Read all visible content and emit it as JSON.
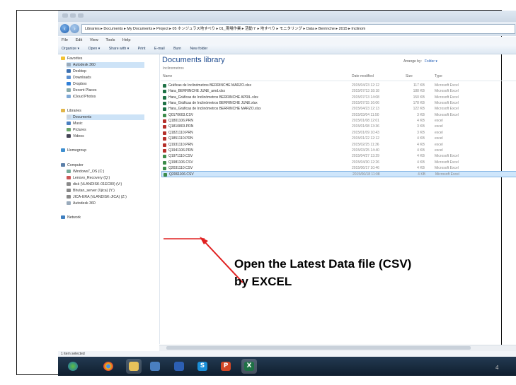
{
  "breadcrumb": "Libraries ▸ Documents ▸ My Documents ▸ Project ▸ 05 ホンジュラス地すべり ▸ 01_現場作業 ▸ 活動７ ▸ 地すべり ▸ モニタリング ▸ Data ▸ Berrinche ▸ 2015 ▸ Inclinom",
  "menu": [
    "File",
    "Edit",
    "View",
    "Tools",
    "Help"
  ],
  "toolbar": [
    "Organize ▾",
    "Open ▾",
    "Share with ▾",
    "Print",
    "E-mail",
    "Burn",
    "New folder"
  ],
  "nav": {
    "favorites": "Favorites",
    "favorites_items": [
      "Autodesk 360",
      "Desktop",
      "Downloads",
      "Dropbox",
      "Recent Places",
      "iCloud Photos"
    ],
    "libraries": "Libraries",
    "libraries_items": [
      "Documents",
      "Music",
      "Pictures",
      "Videos"
    ],
    "homegroup": "Homegroup",
    "computer": "Computer",
    "computer_items": [
      "Windows7_OS (C:)",
      "Lenovo_Recovery (Q:)",
      "disk (\\\\LANDISK-01EC80) (V:)",
      "Bhutan_server (\\\\jica) (Y:)",
      "JICA-ERA (\\\\LANDISK-JICA) (Z:)",
      "Autodesk 360"
    ],
    "network": "Network"
  },
  "library": {
    "title": "Documents library",
    "subtitle": "Inclinometros",
    "arrange_label": "Arrange by:",
    "arrange_value": "Folder ▾"
  },
  "columns": {
    "name": "Name",
    "date": "Date modified",
    "size": "Size",
    "type": "Type"
  },
  "files": [
    {
      "name": "Gráficas de Inclinómetros BERRINCHE MARZO.xlsx",
      "date": "2015/04/23 12:12",
      "size": "117 KB",
      "type": "Microsoft Excel",
      "kind": "xlsx"
    },
    {
      "name": "Hara_BERRINCHE JUNE_amd.xlsx",
      "date": "2015/07/13 18:18",
      "size": "188 KB",
      "type": "Microsoft Excel",
      "kind": "xlsx"
    },
    {
      "name": "Hara_Gráficas de Inclinómetros BERRINCHE APRIL.xlsx",
      "date": "2015/07/13 14:08",
      "size": "150 KB",
      "type": "Microsoft Excel",
      "kind": "xlsx"
    },
    {
      "name": "Hara_Gráficas de Inclinómetros BERRINCHE JUNE.xlsx",
      "date": "2015/07/15 16:06",
      "size": "178 KB",
      "type": "Microsoft Excel",
      "kind": "xlsx"
    },
    {
      "name": "Hara_Gráficas de Inclinómetros BERRINCHE MARZO.xlsx",
      "date": "2015/04/23 12:13",
      "size": "122 KB",
      "type": "Microsoft Excel",
      "kind": "xlsx"
    },
    {
      "name": "Q0170603.CSV",
      "date": "2015/03/04 11:50",
      "size": "3 KB",
      "type": "Microsoft Excel",
      "kind": "csv"
    },
    {
      "name": "Q1801106.PRN",
      "date": "2015/01/08 12:01",
      "size": "4 KB",
      "type": "excel",
      "kind": "prn"
    },
    {
      "name": "Q1810803.PRN",
      "date": "2015/01/08 13:36",
      "size": "3 KB",
      "type": "excel",
      "kind": "prn"
    },
    {
      "name": "Q1821110.PRN",
      "date": "2015/01/09 10:43",
      "size": "3 KB",
      "type": "excel",
      "kind": "prn"
    },
    {
      "name": "Q1851110.PRN",
      "date": "2015/01/22 12:12",
      "size": "4 KB",
      "type": "excel",
      "kind": "prn"
    },
    {
      "name": "Q1931110.PRN",
      "date": "2015/02/25 11:36",
      "size": "4 KB",
      "type": "excel",
      "kind": "prn"
    },
    {
      "name": "Q1941106.PRN",
      "date": "2015/03/25 14:40",
      "size": "4 KB",
      "type": "excel",
      "kind": "prn"
    },
    {
      "name": "Q1971110.CSV",
      "date": "2015/04/27 13:29",
      "size": "4 KB",
      "type": "Microsoft Excel",
      "kind": "csv"
    },
    {
      "name": "Q1981106.CSV",
      "date": "2015/04/30 12:26",
      "size": "4 KB",
      "type": "Microsoft Excel",
      "kind": "csv"
    },
    {
      "name": "Q2031110.CSV",
      "date": "2015/06/17 10:46",
      "size": "4 KB",
      "type": "Microsoft Excel",
      "kind": "csv"
    },
    {
      "name": "Q2061106.CSV",
      "date": "2015/06/18 11:08",
      "size": "4 KB",
      "type": "Microsoft Excel",
      "kind": "csv"
    }
  ],
  "status": "1 item selected",
  "taskbar": {
    "skype_glyph": "S",
    "powerpoint_glyph": "P",
    "excel_glyph": "X"
  },
  "annotation": {
    "line1": "Open the Latest Data file (CSV)",
    "line2": "by EXCEL",
    "color": "#e02020"
  },
  "page_number": "4"
}
